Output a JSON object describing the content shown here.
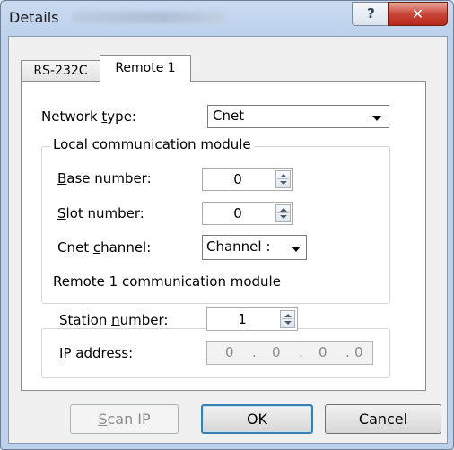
{
  "window": {
    "title": "Details",
    "help_glyph": "?",
    "close_glyph": "✕"
  },
  "tabs": [
    {
      "label": "RS-232C",
      "active": false
    },
    {
      "label": "Remote 1",
      "active": true
    }
  ],
  "network_type": {
    "label_pre": "Network ",
    "label_ul": "t",
    "label_post": "ype:",
    "value": "Cnet"
  },
  "local_group": {
    "title": "Local communication module",
    "base_number": {
      "label_ul": "B",
      "label_post": "ase number:",
      "value": "0"
    },
    "slot_number": {
      "label_ul": "S",
      "label_post": "lot number:",
      "value": "0"
    },
    "cnet_channel": {
      "label_pre": "Cnet ",
      "label_ul": "c",
      "label_post": "hannel:",
      "value": "Channel :"
    }
  },
  "remote_group": {
    "title": "Remote 1 communication module",
    "station_number": {
      "label_pre": "Station ",
      "label_ul": "n",
      "label_post": "umber:",
      "value": "1"
    },
    "ip_address": {
      "label_ul": "I",
      "label_post": "P address:",
      "octets": [
        "0",
        "0",
        "0",
        "0"
      ],
      "separator": "."
    }
  },
  "buttons": {
    "scan_ip_ul": "S",
    "scan_ip_rest": "can IP",
    "ok": "OK",
    "cancel": "Cancel"
  },
  "colors": {
    "titlebar": "#bcd1ec",
    "close_button": "#c9463a",
    "default_button_border": "#3c7fb1"
  }
}
